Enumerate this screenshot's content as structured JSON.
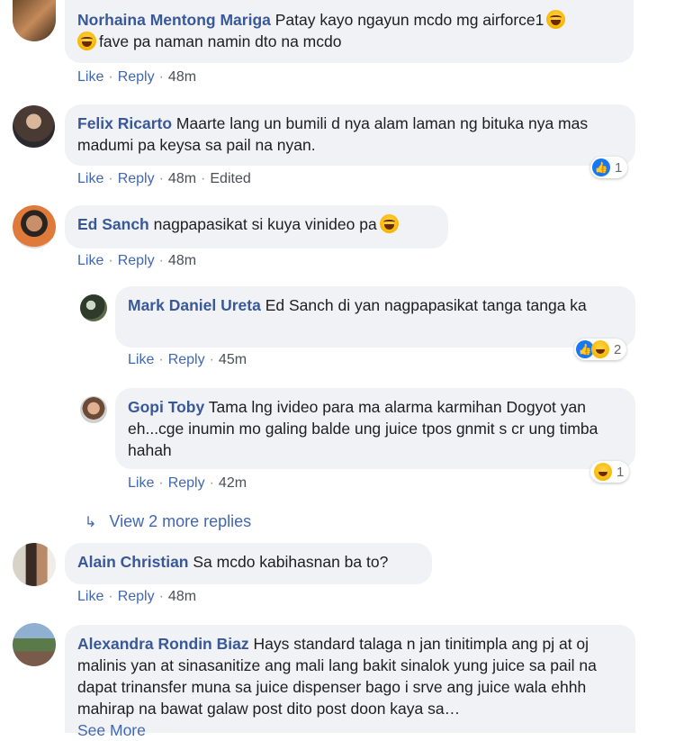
{
  "comments": [
    {
      "author": "Norhaina Mentong Mariga",
      "text": "Patay kayo ngayun mcdo mg airforce1",
      "text2": "fave pa naman namin dto na mcdo",
      "like": "Like",
      "reply": "Reply",
      "time": "48m"
    },
    {
      "author": "Felix Ricarto",
      "text": "Maarte lang un bumili d nya alam laman ng bituka nya mas madumi pa keysa sa pail na nyan.",
      "like": "Like",
      "reply": "Reply",
      "time": "48m",
      "edited": "Edited",
      "reaction_count": "1"
    },
    {
      "author": "Ed Sanch",
      "text": "nagpapasikat si kuya vinideo pa",
      "like": "Like",
      "reply": "Reply",
      "time": "48m"
    },
    {
      "author": "Alain Christian",
      "text": "Sa mcdo kabihasnan ba to?",
      "like": "Like",
      "reply": "Reply",
      "time": "48m"
    },
    {
      "author": "Alexandra Rondin Biaz",
      "text": "Hays standard talaga n jan tinitimpla ang pj at oj malinis yan at sinasanitize ang mali lang bakit sinalok yung juice sa pail na dapat trinansfer muna sa juice dispenser bago i srve ang juice wala ehhh mahirap na bawat galaw post dito post doon kaya sa…",
      "see_more": "See More"
    }
  ],
  "replies": [
    {
      "author": "Mark Daniel Ureta",
      "text": "Ed Sanch di yan nagpapasikat tanga tanga ka",
      "like": "Like",
      "reply": "Reply",
      "time": "45m",
      "reaction_count": "2"
    },
    {
      "author": "Gopi Toby",
      "text": "Tama lng ivideo para ma alarma karmihan Dogyot yan eh...cge inumin mo galing balde ung juice tpos gnmit s cr ung timba hahah",
      "like": "Like",
      "reply": "Reply",
      "time": "42m",
      "reaction_count": "1"
    }
  ],
  "view_more_replies": "View 2 more replies",
  "icons": {
    "like_reaction": "thumbs-up-icon",
    "haha_reaction": "haha-emoji-icon",
    "reply_arrow": "reply-arrow-icon"
  },
  "colors": {
    "name": "#385898",
    "link": "#4267b2",
    "bubble": "#f0f2f5",
    "like_blue": "#1877f2"
  }
}
